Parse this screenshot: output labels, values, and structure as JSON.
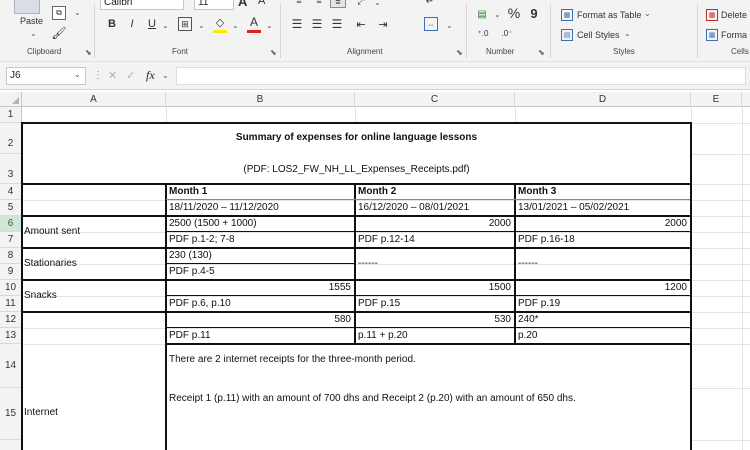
{
  "ribbon": {
    "clipboard": {
      "paste_label": "Paste",
      "group_label": "Clipboard"
    },
    "font": {
      "font_name": "Calibri",
      "font_size": "11",
      "bold": "B",
      "italic": "I",
      "underline": "U",
      "group_label": "Font",
      "grow": "A",
      "shrink": "A",
      "font_color_glyph": "A"
    },
    "alignment": {
      "group_label": "Alignment"
    },
    "number": {
      "group_label": "Number",
      "percent": "%",
      "comma": "9"
    },
    "styles": {
      "format_as_table": "Format as Table",
      "cell_styles": "Cell Styles",
      "group_label": "Styles"
    },
    "cells": {
      "delete": "Delete",
      "format": "Forma",
      "group_label": "Cells"
    },
    "accent_font_color": "#e02020",
    "accent_highlight": "#ffe600"
  },
  "formula_bar": {
    "name_box": "J6",
    "fx": "fx",
    "formula": ""
  },
  "columns": [
    "A",
    "B",
    "C",
    "D",
    "E"
  ],
  "rows": [
    "1",
    "2",
    "3",
    "4",
    "5",
    "6",
    "7",
    "8",
    "9",
    "10",
    "11",
    "12",
    "13",
    "14",
    "15"
  ],
  "sheet": {
    "title": "Summary of expenses for online language lessons",
    "subtitle": "(PDF: LOS2_FW_NH_LL_Expenses_Receipts.pdf)",
    "month_headers": [
      "Month 1",
      "Month 2",
      "Month 3"
    ],
    "month_ranges": [
      "18/11/2020 – 11/12/2020",
      "16/12/2020 – 08/01/2021",
      "13/01/2021 – 05/02/2021"
    ],
    "amount_sent": {
      "label": "Amount sent",
      "values": [
        "2500 (1500 + 1000)",
        "2000",
        "2000"
      ],
      "refs": [
        "PDF p.1-2; 7-8",
        "PDF p.12-14",
        "PDF p.16-18"
      ]
    },
    "stationaries": {
      "label": "Stationaries",
      "values": [
        "230 (130)",
        "------",
        "------"
      ],
      "refs": [
        "PDF p.4-5"
      ]
    },
    "snacks": {
      "label": "Snacks",
      "values": [
        "1555",
        "1500",
        "1200"
      ],
      "refs": [
        "PDF p.6, p.10",
        "PDF p.15",
        "PDF p.19"
      ]
    },
    "internet": {
      "label": "Internet",
      "values": [
        "580",
        "530",
        "240*"
      ],
      "refs": [
        "PDF p.11",
        "p.11 + p.20",
        "p.20"
      ],
      "note1": "There are 2 internet receipts for the three-month period.",
      "note2": "Receipt 1 (p.11) with an amount of 700 dhs and Receipt 2 (p.20) with an amount of 650 dhs."
    }
  }
}
